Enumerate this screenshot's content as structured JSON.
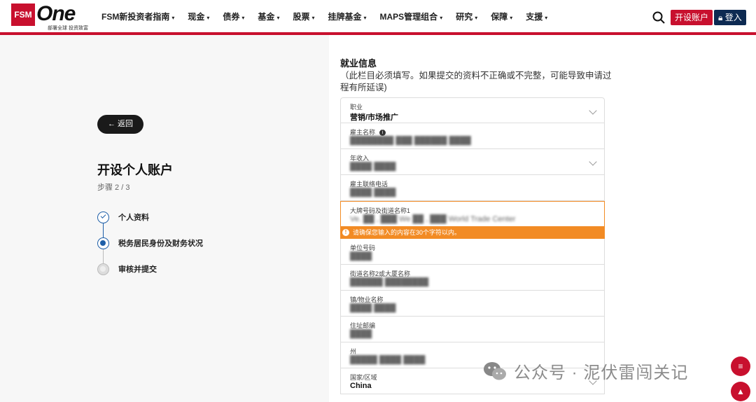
{
  "header": {
    "logo": {
      "fsm": "FSM",
      "one": "One",
      "sub": "部署全球 投资致富"
    },
    "nav": [
      {
        "label": "FSM新投资者指南"
      },
      {
        "label": "现金"
      },
      {
        "label": "债券"
      },
      {
        "label": "基金"
      },
      {
        "label": "股票"
      },
      {
        "label": "挂牌基金"
      },
      {
        "label": "MAPS管理组合"
      },
      {
        "label": "研究"
      },
      {
        "label": "保障"
      },
      {
        "label": "支援"
      }
    ],
    "open_account": "开设账户",
    "login": "登入"
  },
  "left": {
    "back": "返回",
    "title": "开设个人账户",
    "step": "步骤 2 / 3",
    "steps": [
      {
        "label": "个人资料",
        "status": "done"
      },
      {
        "label": "税务居民身份及财务状况",
        "status": "active"
      },
      {
        "label": "审核并提交",
        "status": "pending"
      }
    ]
  },
  "form": {
    "section_title": "就业信息",
    "note": "（此栏目必须填写。如果提交的资料不正确或不完整，可能导致申请过程有所延误)",
    "fields": [
      {
        "label": "职业",
        "value": "营销/市场推广"
      },
      {
        "label": "雇主名称",
        "value": "████████ ███ ██████ ████"
      },
      {
        "label": "年收入",
        "value": "████ ████"
      },
      {
        "label": "雇主联络电话",
        "value": "████ ████"
      },
      {
        "label": "大牌号码及街道名称1",
        "value": "Ve. ██ , ███ We ██ , ███ World Trade Center"
      },
      {
        "label": "单位号码",
        "value": "████"
      },
      {
        "label": "街道名称2或大厦名称",
        "value": "██████ ████████"
      },
      {
        "label": "镇/物业名称",
        "value": "████ ████"
      },
      {
        "label": "住址邮编",
        "value": "████"
      },
      {
        "label": "州",
        "value": "█████ ████ ████"
      },
      {
        "label": "国家/区域",
        "value": "China"
      }
    ],
    "error_message": "请确保您输入的内容在30个字符以内。"
  },
  "watermark": "公众号 · 泥伏雷闯关记"
}
